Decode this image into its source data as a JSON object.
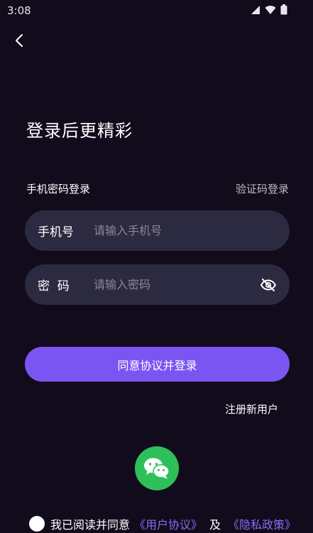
{
  "status_bar": {
    "time": "3:08"
  },
  "page": {
    "title": "登录后更精彩"
  },
  "login": {
    "mode_label": "手机密码登录",
    "switch_mode": "验证码登录",
    "phone": {
      "label": "手机号",
      "value": "",
      "placeholder": "请输入手机号"
    },
    "password": {
      "label": "密  码",
      "value": "",
      "placeholder": "请输入密码"
    },
    "submit_label": "同意协议并登录",
    "register_label": "注册新用户"
  },
  "agreement": {
    "prefix": "我已阅读并同意",
    "user_agreement": "《用户协议》",
    "and": "及",
    "privacy_policy": "《隐私政策》"
  },
  "colors": {
    "background": "#120b1c",
    "field_background": "#2c2a40",
    "accent": "#7b55f2",
    "link": "#8a6cf5",
    "wechat": "#2dc05a"
  }
}
